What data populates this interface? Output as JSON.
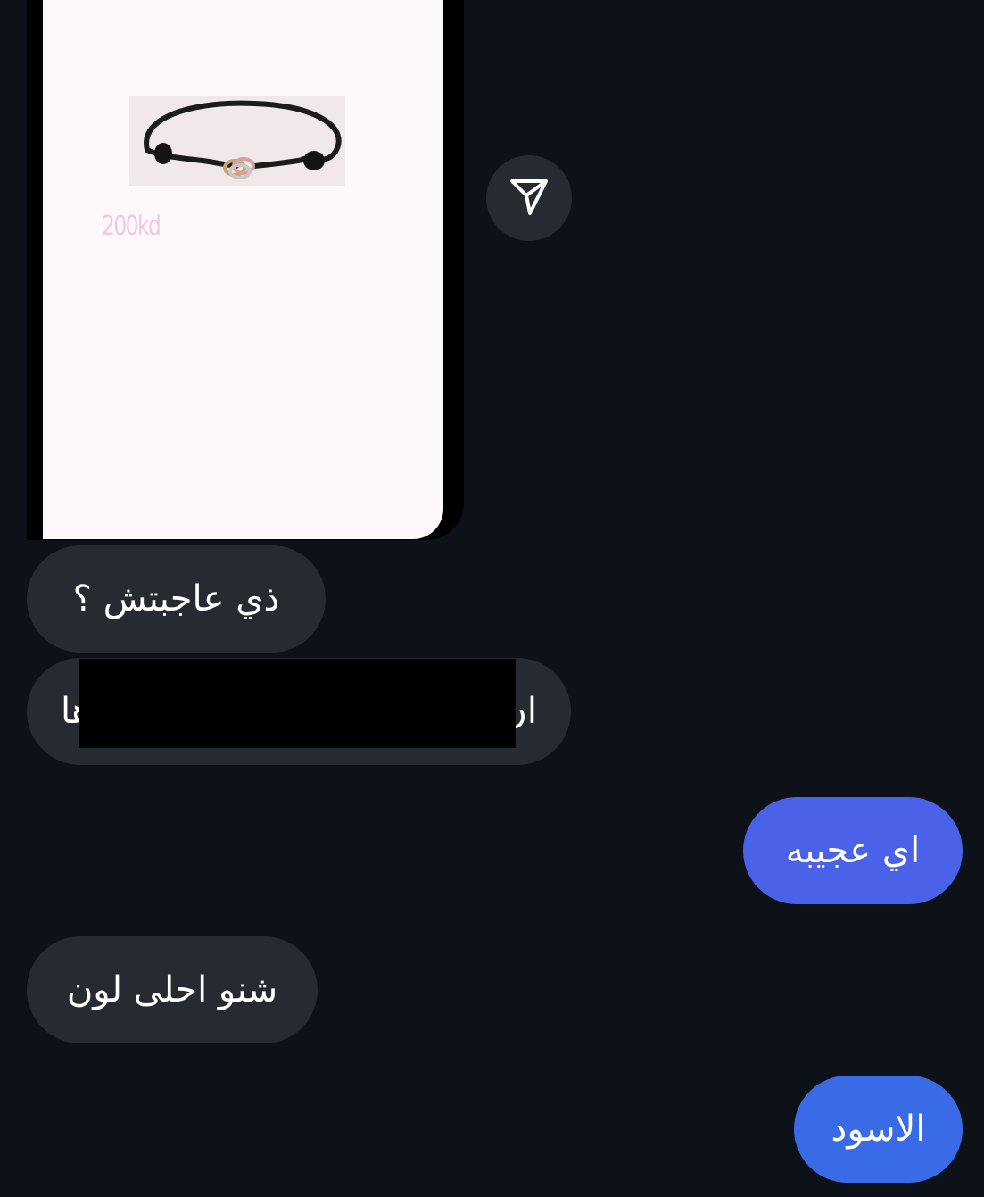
{
  "shared_post": {
    "price": "200kd",
    "photo_icon": "bracelet-icon"
  },
  "share_button": {
    "icon": "send-icon"
  },
  "messages": [
    {
      "direction": "incoming",
      "text": "ذي عاجبتش ؟"
    },
    {
      "direction": "incoming",
      "text_start": "ان",
      "text_end": "ها",
      "redacted": true
    },
    {
      "direction": "outgoing",
      "text": "اي عجيبه"
    },
    {
      "direction": "incoming",
      "text": "شنو احلى لون"
    },
    {
      "direction": "outgoing",
      "text": "الاسود"
    }
  ],
  "colors": {
    "background": "#0d1118",
    "incoming_bubble": "#262a31",
    "outgoing_bubble_top": "#4a62e8",
    "outgoing_bubble_bottom": "#3a6be6",
    "text": "#ffffff"
  }
}
